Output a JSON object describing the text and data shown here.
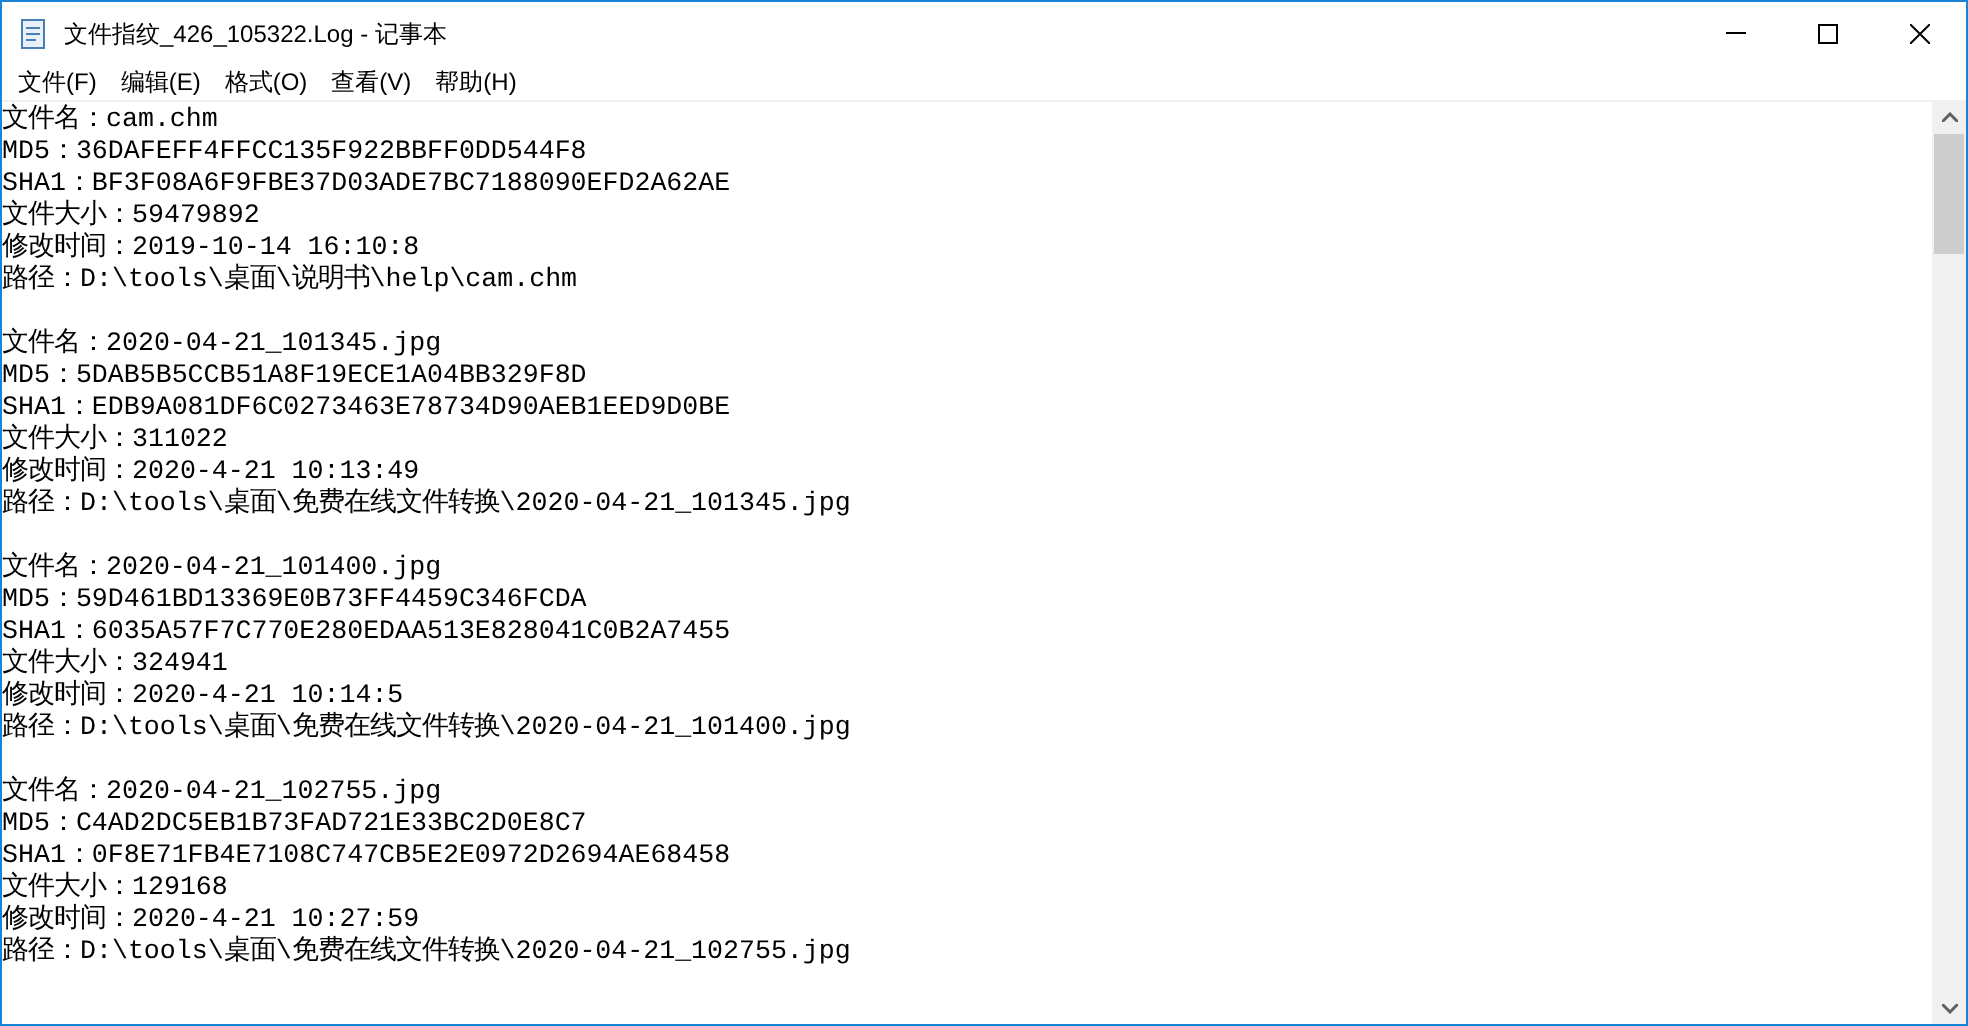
{
  "window": {
    "title": "文件指纹_426_105322.Log - 记事本"
  },
  "menu": [
    "文件(F)",
    "编辑(E)",
    "格式(O)",
    "查看(V)",
    "帮助(H)"
  ],
  "entries": [
    {
      "lines": [
        "文件名：cam.chm",
        "MD5：36DAFEFF4FFCC135F922BBFF0DD544F8",
        "SHA1：BF3F08A6F9FBE37D03ADE7BC7188090EFD2A62AE",
        "文件大小：59479892",
        "修改时间：2019-10-14 16:10:8",
        "路径：D:\\tools\\桌面\\说明书\\help\\cam.chm"
      ]
    },
    {
      "lines": [
        "文件名：2020-04-21_101345.jpg",
        "MD5：5DAB5B5CCB51A8F19ECE1A04BB329F8D",
        "SHA1：EDB9A081DF6C0273463E78734D90AEB1EED9D0BE",
        "文件大小：311022",
        "修改时间：2020-4-21 10:13:49",
        "路径：D:\\tools\\桌面\\免费在线文件转换\\2020-04-21_101345.jpg"
      ]
    },
    {
      "lines": [
        "文件名：2020-04-21_101400.jpg",
        "MD5：59D461BD13369E0B73FF4459C346FCDA",
        "SHA1：6035A57F7C770E280EDAA513E828041C0B2A7455",
        "文件大小：324941",
        "修改时间：2020-4-21 10:14:5",
        "路径：D:\\tools\\桌面\\免费在线文件转换\\2020-04-21_101400.jpg"
      ]
    },
    {
      "lines": [
        "文件名：2020-04-21_102755.jpg",
        "MD5：C4AD2DC5EB1B73FAD721E33BC2D0E8C7",
        "SHA1：0F8E71FB4E7108C747CB5E2E0972D2694AE68458",
        "文件大小：129168",
        "修改时间：2020-4-21 10:27:59",
        "路径：D:\\tools\\桌面\\免费在线文件转换\\2020-04-21_102755.jpg"
      ]
    }
  ]
}
